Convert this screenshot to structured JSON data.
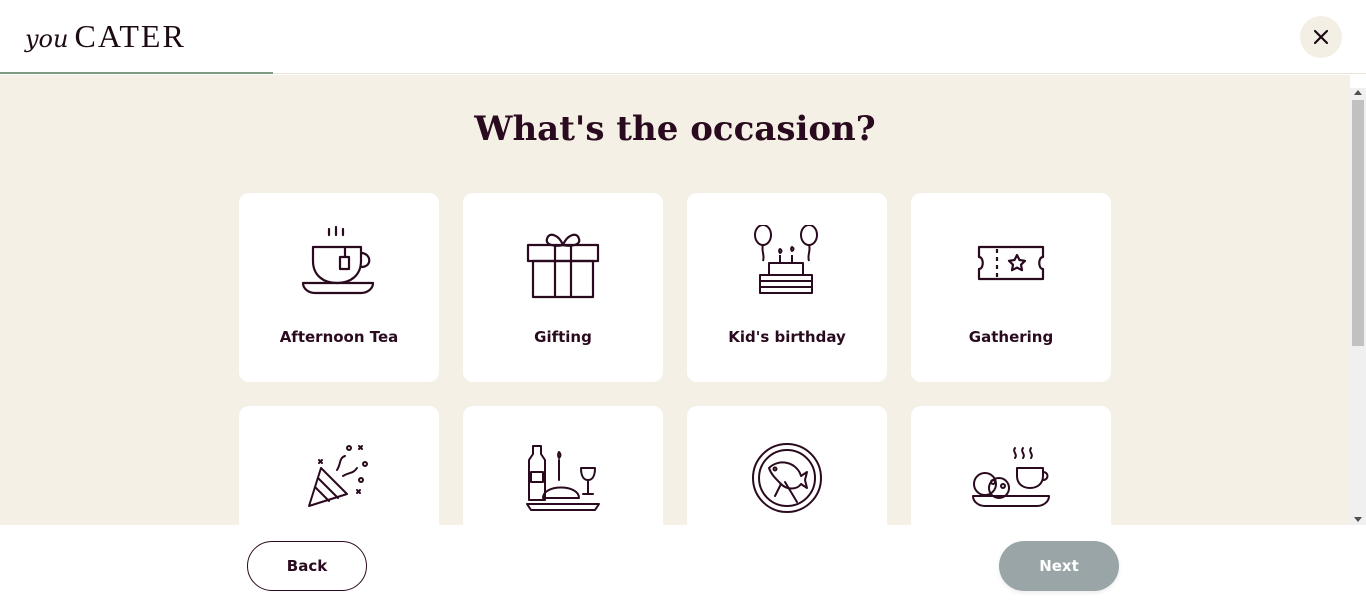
{
  "header": {
    "logo_you": "you",
    "logo_cater": "CATER",
    "close_icon": "close-icon"
  },
  "main": {
    "title": "What's the occasion?",
    "occasions": [
      {
        "label": "Afternoon Tea",
        "icon": "teacup-icon"
      },
      {
        "label": "Gifting",
        "icon": "gift-box-icon"
      },
      {
        "label": "Kid's birthday",
        "icon": "birthday-cake-icon"
      },
      {
        "label": "Gathering",
        "icon": "ticket-icon"
      },
      {
        "label": "",
        "icon": "party-popper-icon"
      },
      {
        "label": "",
        "icon": "dinner-table-icon"
      },
      {
        "label": "",
        "icon": "fish-plate-icon"
      },
      {
        "label": "",
        "icon": "tea-and-biscuits-icon"
      }
    ]
  },
  "footer": {
    "back_label": "Back",
    "next_label": "Next"
  },
  "colors": {
    "brand_dark": "#2a0a1e",
    "background_cream": "#f5f0e6",
    "progress_green": "#7e9c7f",
    "next_disabled": "#9aa5a8"
  }
}
